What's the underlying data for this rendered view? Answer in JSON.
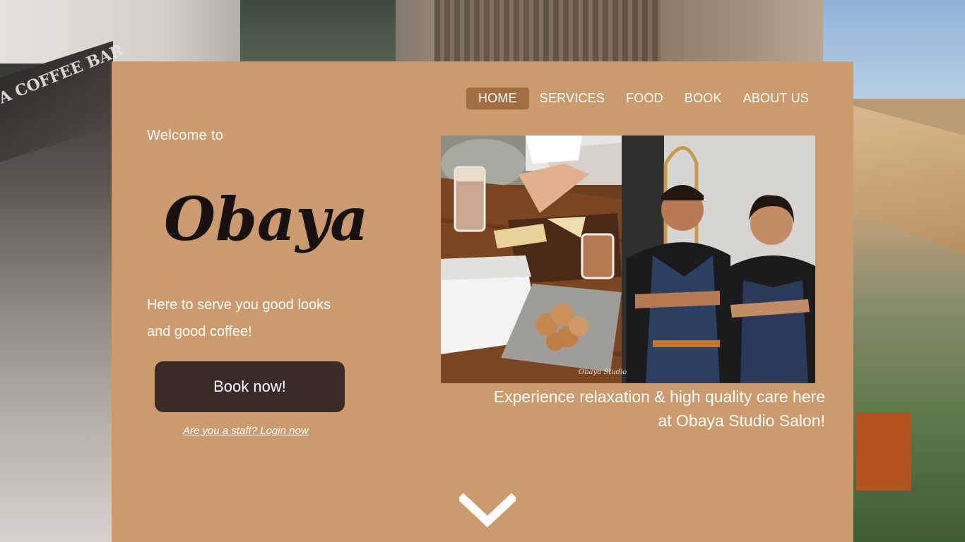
{
  "nav": {
    "items": [
      {
        "label": "HOME",
        "active": true
      },
      {
        "label": "SERVICES",
        "active": false
      },
      {
        "label": "FOOD",
        "active": false
      },
      {
        "label": "BOOK",
        "active": false
      },
      {
        "label": "ABOUT US",
        "active": false
      }
    ]
  },
  "hero": {
    "welcome": "Welcome to",
    "logo_text": "Obaya",
    "tagline_line1": "Here to serve you good looks",
    "tagline_line2": "and good coffee!",
    "book_button": "Book now!",
    "staff_link": "Are you a staff? Login now",
    "caption_line1": "Experience relaxation & high quality care here",
    "caption_line2": "at Obaya Studio Salon!"
  },
  "background": {
    "sign_text": "YA COFFEE BAR"
  },
  "icons": {
    "scroll": "chevron-down-icon"
  },
  "colors": {
    "panel": "#cc9b6d",
    "nav_active": "#a26e3f",
    "button": "#3b2b28",
    "text": "#ffffff"
  }
}
